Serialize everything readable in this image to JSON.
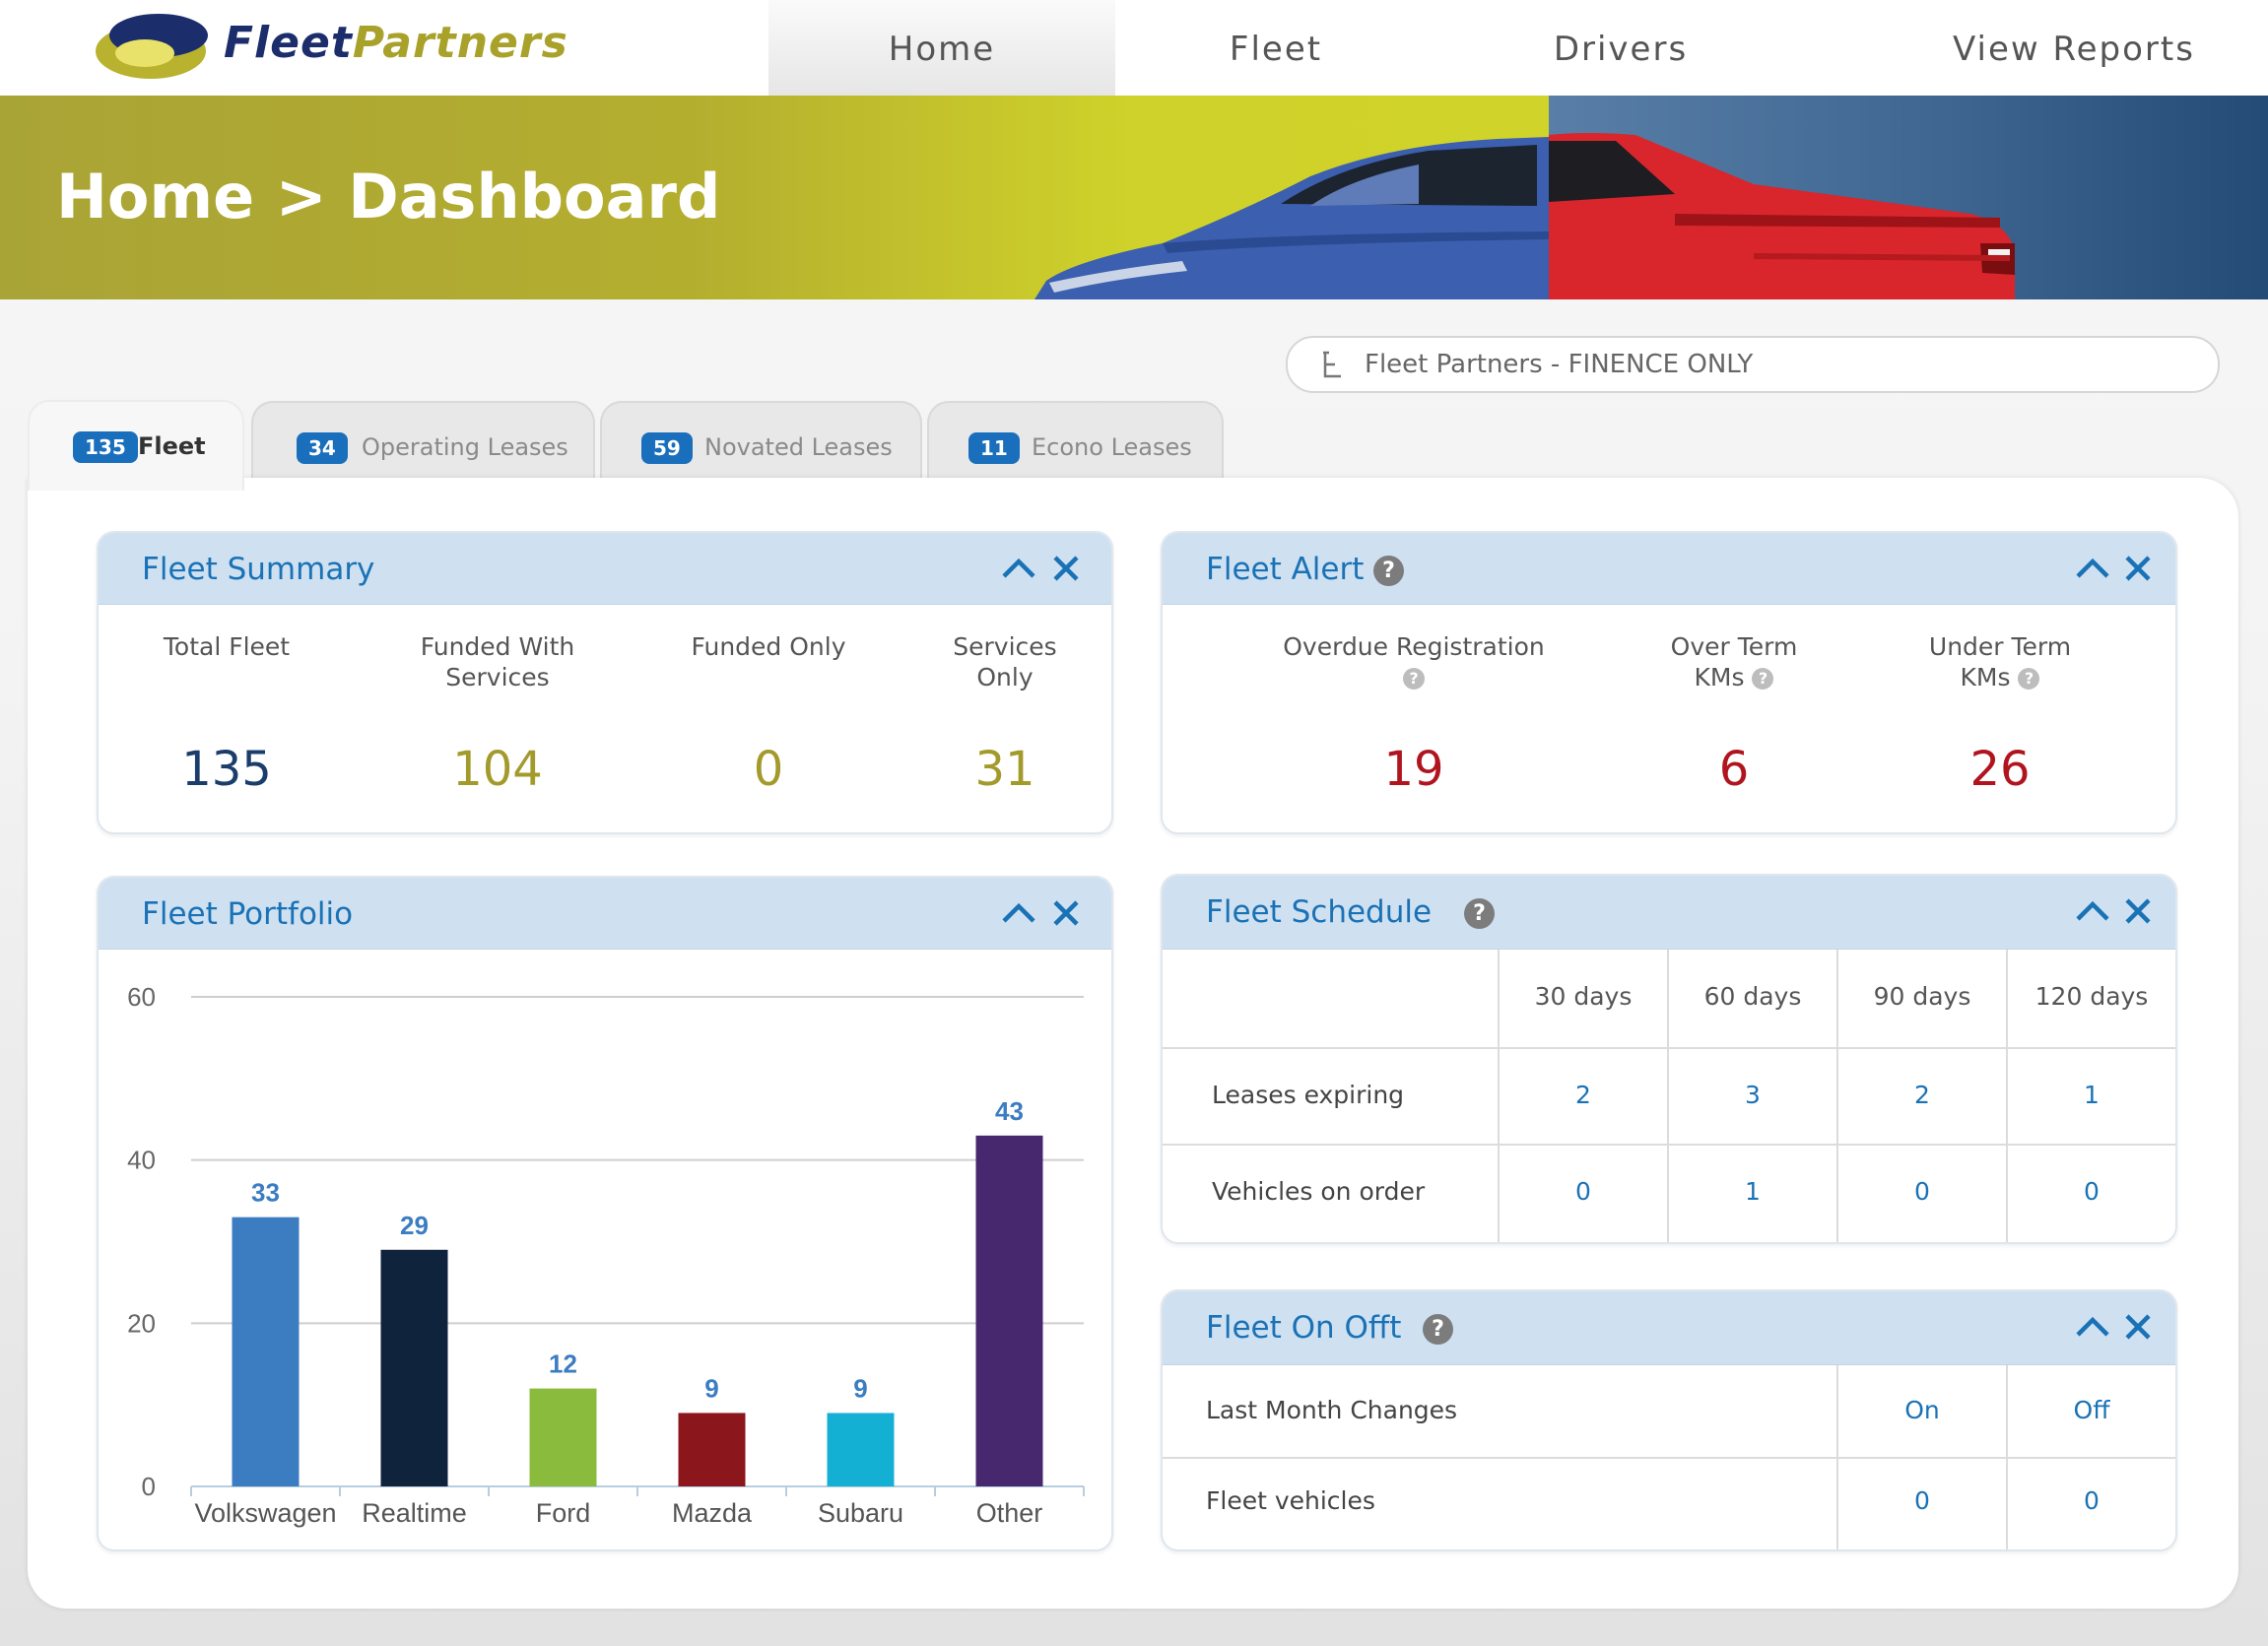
{
  "brand": {
    "name_part1": "Fleet",
    "name_part2": "Partners"
  },
  "nav": {
    "home": "Home",
    "fleet": "Fleet",
    "drivers": "Drivers",
    "reports": "View Reports"
  },
  "banner": {
    "title": "Home > Dashboard"
  },
  "account_selector": {
    "value": "Fleet Partners - FINENCE ONLY"
  },
  "tabs": [
    {
      "count": "135",
      "label": "Fleet"
    },
    {
      "count": "34",
      "label": "Operating Leases"
    },
    {
      "count": "59",
      "label": "Novated Leases"
    },
    {
      "count": "11",
      "label": "Econo Leases"
    }
  ],
  "fleet_summary": {
    "title": "Fleet Summary",
    "stats": [
      {
        "label_1": "Total Fleet",
        "label_2": "",
        "value": "135",
        "color": "#1b3d6b"
      },
      {
        "label_1": "Funded With",
        "label_2": "Services",
        "value": "104",
        "color": "#a39a2c"
      },
      {
        "label_1": "Funded Only",
        "label_2": "",
        "value": "0",
        "color": "#a39a2c"
      },
      {
        "label_1": "Services",
        "label_2": "Only",
        "value": "31",
        "color": "#a39a2c"
      }
    ]
  },
  "fleet_alert": {
    "title": "Fleet Alert",
    "stats": [
      {
        "label_1": "Overdue Registration",
        "label_2": "",
        "value": "19"
      },
      {
        "label_1": "Over Term",
        "label_2": "KMs",
        "value": "6"
      },
      {
        "label_1": "Under Term",
        "label_2": "KMs",
        "value": "26"
      }
    ],
    "value_color": "#b0151f"
  },
  "fleet_portfolio": {
    "title": "Fleet Portfolio"
  },
  "chart_data": {
    "type": "bar",
    "categories": [
      "Volkswagen",
      "Realtime",
      "Ford",
      "Mazda",
      "Subaru",
      "Other"
    ],
    "values": [
      33,
      29,
      12,
      9,
      9,
      43
    ],
    "colors": [
      "#3c7dc2",
      "#10233d",
      "#8bbb3c",
      "#8b161b",
      "#14b0d4",
      "#47286e"
    ],
    "ylim": [
      0,
      60
    ],
    "yticks": [
      0,
      20,
      40,
      60
    ],
    "grid": true,
    "title": "",
    "xlabel": "",
    "ylabel": ""
  },
  "fleet_schedule": {
    "title": "Fleet Schedule",
    "columns": [
      "30 days",
      "60 days",
      "90 days",
      "120 days"
    ],
    "rows": [
      {
        "label": "Leases expiring",
        "values": [
          "2",
          "3",
          "2",
          "1"
        ]
      },
      {
        "label": "Vehicles on order",
        "values": [
          "0",
          "1",
          "0",
          "0"
        ]
      }
    ]
  },
  "fleet_onoff": {
    "title": "Fleet On Offt",
    "header_label": "Last Month Changes",
    "columns": [
      "On",
      "Off"
    ],
    "rows": [
      {
        "label": "Fleet vehicles",
        "values": [
          "0",
          "0"
        ]
      }
    ]
  },
  "icons": {
    "help": "help-icon",
    "collapse": "chevron-up-icon",
    "close": "close-icon",
    "tree": "tree-icon"
  },
  "colors": {
    "accent": "#1a72b6",
    "badge": "#1a6fbd",
    "header_bg": "#cfe0f1"
  }
}
